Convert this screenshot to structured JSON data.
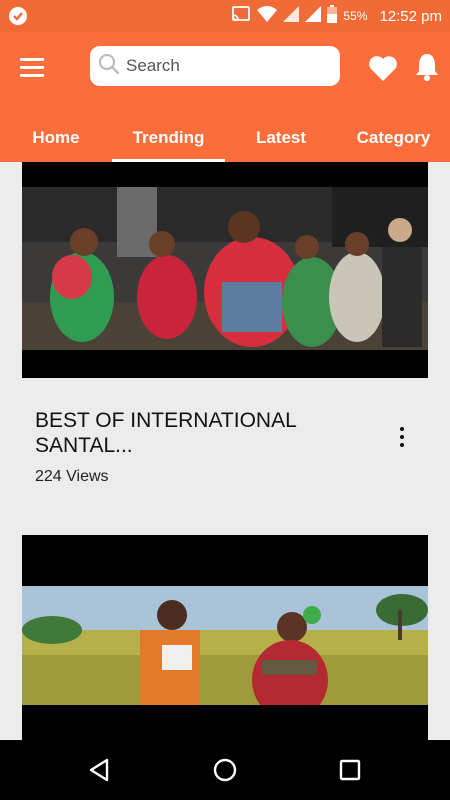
{
  "status_bar": {
    "battery_percent": "55%",
    "time": "12:52 pm",
    "icons": [
      "app-notification-icon",
      "cast-icon",
      "wifi-icon",
      "signal-icon",
      "signal-icon",
      "battery-icon"
    ]
  },
  "app_bar": {
    "search_placeholder": "Search",
    "menu_icon": "hamburger-menu-icon",
    "favorites_icon": "heart-icon",
    "notifications_icon": "bell-icon"
  },
  "tabs": [
    {
      "label": "Home"
    },
    {
      "label": "Trending"
    },
    {
      "label": "Latest"
    },
    {
      "label": "Category"
    }
  ],
  "active_tab": "Trending",
  "videos": [
    {
      "title": "BEST OF INTERNATIONAL SANTAL...",
      "views": "224 Views"
    },
    {
      "title": "",
      "views": ""
    }
  ],
  "nav_bar": {
    "icons": [
      "back-icon",
      "home-icon",
      "recents-icon"
    ]
  },
  "colors": {
    "status_bar": "#f26a35",
    "app_bar": "#fb6d3a",
    "background": "#ececec"
  }
}
